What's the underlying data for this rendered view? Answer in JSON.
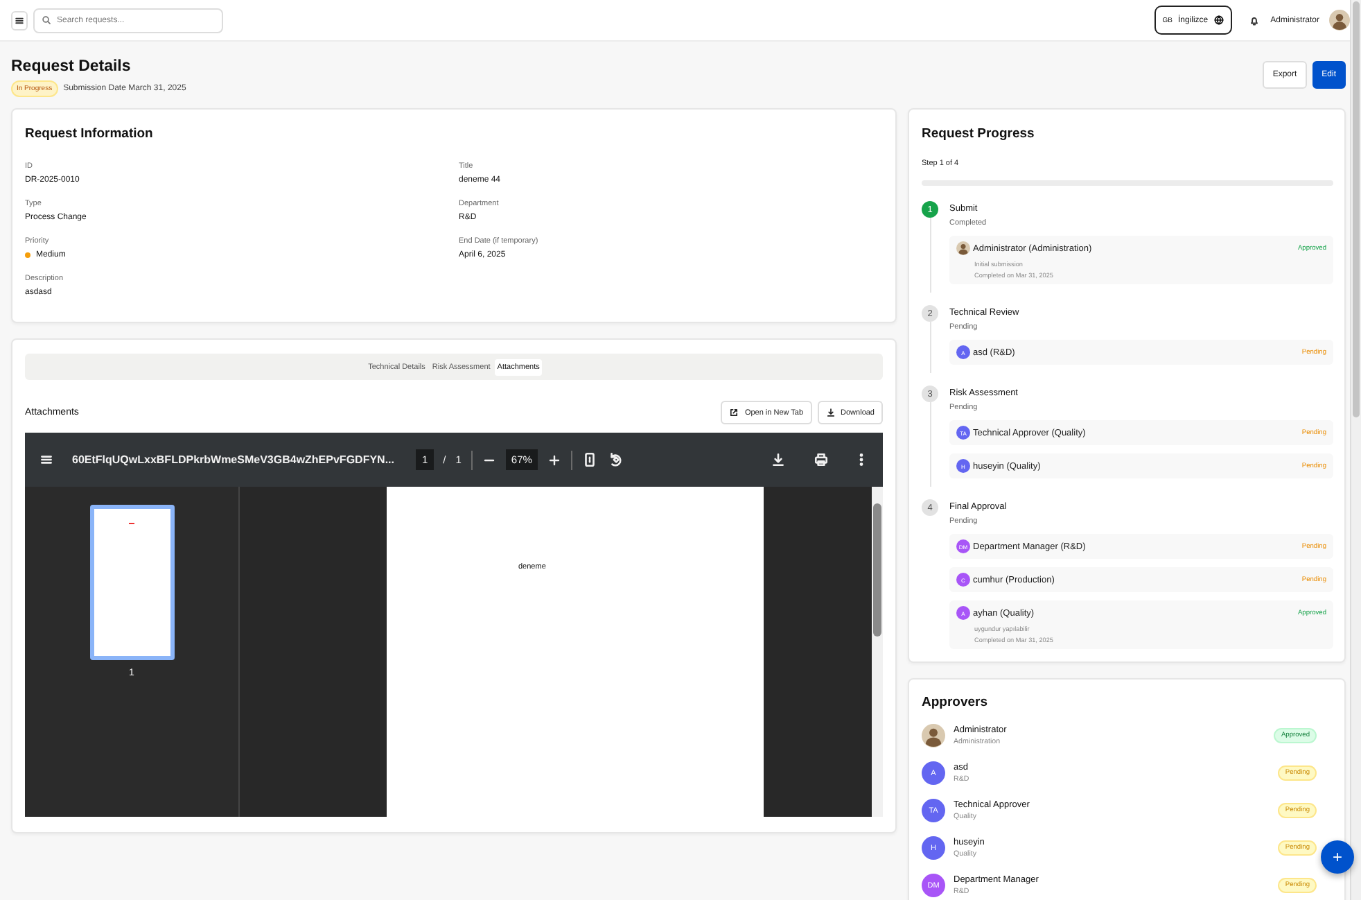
{
  "topbar": {
    "search_placeholder": "Search requests...",
    "language_code": "GB",
    "language": "İngilizce",
    "user": "Administrator"
  },
  "header": {
    "title": "Request Details",
    "status": "In Progress",
    "submission": "Submission Date March 31, 2025",
    "buttons": [
      {
        "label": "Export",
        "kind": "secondary"
      },
      {
        "label": "Edit",
        "kind": "primary"
      }
    ]
  },
  "request_information": {
    "title": "Request Information",
    "fields": [
      {
        "label": "ID",
        "value": "DR-2025-0010"
      },
      {
        "label": "Title",
        "value": "deneme 44"
      },
      {
        "label": "Type",
        "value": "Process Change"
      },
      {
        "label": "Department",
        "value": "R&D"
      },
      {
        "label": "Priority",
        "value": "Medium",
        "color": "#f59e0b"
      },
      {
        "label": "End Date (if temporary)",
        "value": "April 6, 2025"
      },
      {
        "label": "Description",
        "value": "asdasd"
      }
    ]
  },
  "attachments": {
    "tabs": [
      {
        "label": "Technical Details",
        "selected": false
      },
      {
        "label": "Risk Assessment",
        "selected": false
      },
      {
        "label": "Attachments",
        "selected": true
      }
    ],
    "title": "Attachments",
    "buttons": [
      {
        "label": "Open in New Tab",
        "kind": "open"
      },
      {
        "label": "Download",
        "kind": "download"
      }
    ],
    "viewer": {
      "file_name": "60EtFlqUQwLxxBFLDPkrbWmeSMeV3GB4wZhEPvFGDFYN...",
      "page": "1",
      "separator": "/",
      "page_count": "1",
      "zoom": "67%",
      "thumbnail_label": "1",
      "page_text": "deneme"
    }
  },
  "request_progress": {
    "title": "Request Progress",
    "step_text": "Step 1 of 4",
    "level": 0,
    "steps": [
      {
        "number": "1",
        "title": "Submit",
        "status": "Completed",
        "completed": true,
        "approvals": [
          {
            "name": "Administrator (Administration)",
            "status": "Approved",
            "kind": "approved",
            "avatar": {
              "kind": "photo"
            },
            "comment": "Initial submission",
            "date": "Completed on Mar 31, 2025"
          }
        ]
      },
      {
        "number": "2",
        "title": "Technical Review",
        "status": "Pending",
        "completed": false,
        "approvals": [
          {
            "name": "asd (R&D)",
            "status": "Pending",
            "kind": "pending",
            "avatar": {
              "kind": "initials",
              "initials": "A",
              "color": "#6366f1"
            }
          }
        ]
      },
      {
        "number": "3",
        "title": "Risk Assessment",
        "status": "Pending",
        "completed": false,
        "approvals": [
          {
            "name": "Technical Approver (Quality)",
            "status": "Pending",
            "kind": "pending",
            "avatar": {
              "kind": "initials",
              "initials": "TA",
              "color": "#6366f1"
            }
          },
          {
            "name": "huseyin (Quality)",
            "status": "Pending",
            "kind": "pending",
            "avatar": {
              "kind": "initials",
              "initials": "H",
              "color": "#6366f1"
            }
          }
        ]
      },
      {
        "number": "4",
        "title": "Final Approval",
        "status": "Pending",
        "completed": false,
        "approvals": [
          {
            "name": "Department Manager (R&D)",
            "status": "Pending",
            "kind": "pending",
            "avatar": {
              "kind": "initials",
              "initials": "DM",
              "color": "#a855f7"
            }
          },
          {
            "name": "cumhur (Production)",
            "status": "Pending",
            "kind": "pending",
            "avatar": {
              "kind": "initials",
              "initials": "C",
              "color": "#a855f7"
            }
          },
          {
            "name": "ayhan (Quality)",
            "status": "Approved",
            "kind": "approved",
            "avatar": {
              "kind": "initials",
              "initials": "A",
              "color": "#a855f7"
            },
            "comment": "uygundur yapılabilir",
            "date": "Completed on Mar 31, 2025"
          }
        ]
      }
    ]
  },
  "approvers": {
    "title": "Approvers",
    "items": [
      {
        "name": "Administrator",
        "department": "Administration",
        "status": "Approved",
        "kind": "approved",
        "avatar": {
          "kind": "photo"
        }
      },
      {
        "name": "asd",
        "department": "R&D",
        "status": "Pending",
        "kind": "pending",
        "avatar": {
          "kind": "initials",
          "initials": "A",
          "color": "#6366f1"
        }
      },
      {
        "name": "Technical Approver",
        "department": "Quality",
        "status": "Pending",
        "kind": "pending",
        "avatar": {
          "kind": "initials",
          "initials": "TA",
          "color": "#6366f1"
        }
      },
      {
        "name": "huseyin",
        "department": "Quality",
        "status": "Pending",
        "kind": "pending",
        "avatar": {
          "kind": "initials",
          "initials": "H",
          "color": "#6366f1"
        }
      },
      {
        "name": "Department Manager",
        "department": "R&D",
        "status": "Pending",
        "kind": "pending",
        "avatar": {
          "kind": "initials",
          "initials": "DM",
          "color": "#a855f7"
        }
      }
    ]
  },
  "fab": "+"
}
